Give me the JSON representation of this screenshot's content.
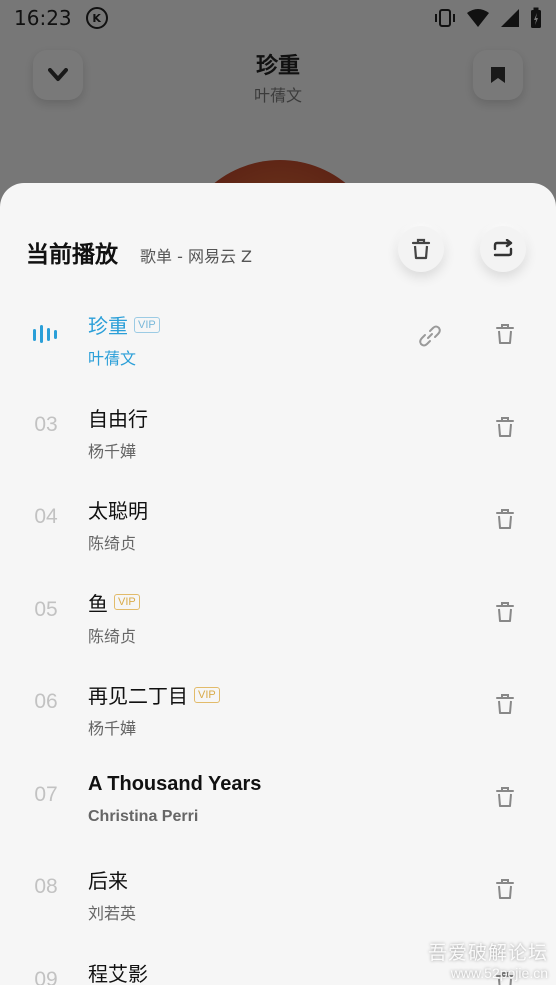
{
  "status_bar": {
    "time": "16:23",
    "badge": "K"
  },
  "player": {
    "title": "珍重",
    "artist": "叶蒨文"
  },
  "playlist": {
    "title": "当前播放",
    "source": "歌单 - 网易云 Z",
    "items": [
      {
        "index": "",
        "title": "珍重",
        "artist": "叶蒨文",
        "vip": "VIP",
        "playing": true
      },
      {
        "index": "03",
        "title": "自由行",
        "artist": "杨千嬅",
        "vip": ""
      },
      {
        "index": "04",
        "title": "太聪明",
        "artist": "陈绮贞",
        "vip": ""
      },
      {
        "index": "05",
        "title": "鱼",
        "artist": "陈绮贞",
        "vip": "VIP"
      },
      {
        "index": "06",
        "title": "再见二丁目",
        "artist": "杨千嬅",
        "vip": "VIP"
      },
      {
        "index": "07",
        "title": "A Thousand Years",
        "artist": "Christina Perri",
        "vip": ""
      },
      {
        "index": "08",
        "title": "后来",
        "artist": "刘若英",
        "vip": ""
      },
      {
        "index": "09",
        "title": "程艾影",
        "artist": "",
        "vip": ""
      }
    ]
  },
  "watermark": {
    "line1": "吾爱破解论坛",
    "line2": "www.52pojie.cn"
  },
  "colors": {
    "accent": "#2b9fd8",
    "vip": "#d9ab4a",
    "sheet_bg": "#f6f6f6"
  }
}
